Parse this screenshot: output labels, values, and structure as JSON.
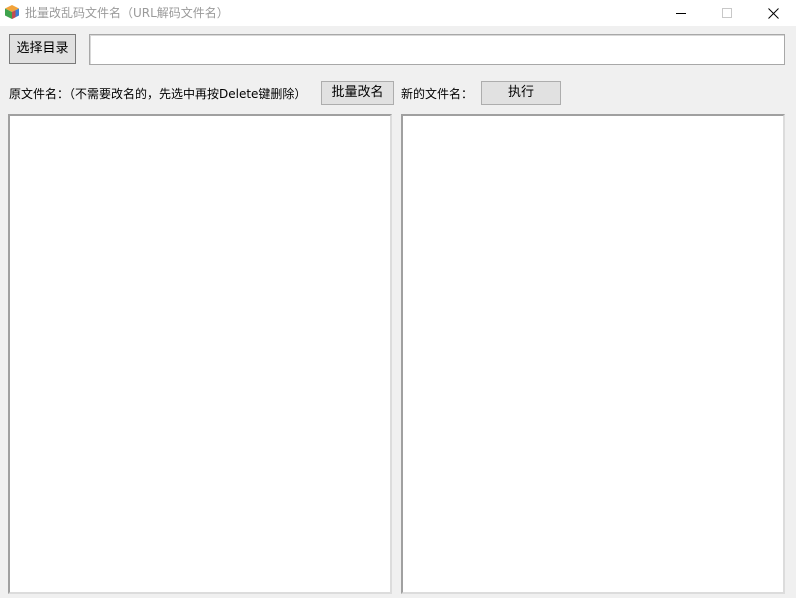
{
  "window": {
    "title": "批量改乱码文件名（URL解码文件名）",
    "controls": {
      "minimize": "—",
      "maximize": "☐",
      "close": "✕"
    }
  },
  "toolbar": {
    "select_dir_label": "选择目录",
    "path_value": ""
  },
  "actions": {
    "orig_label": "原文件名：（不需要改名的，先选中再按Delete键删除）",
    "batch_rename_label": "批量改名",
    "new_label": "新的文件名：",
    "execute_label": "执行"
  },
  "lists": {
    "original_files": [],
    "new_files": []
  },
  "colors": {
    "window_bg": "#f0f0f0",
    "title_text": "#9a9a9a",
    "button_bg": "#e1e1e1",
    "button_border": "#adadad"
  }
}
